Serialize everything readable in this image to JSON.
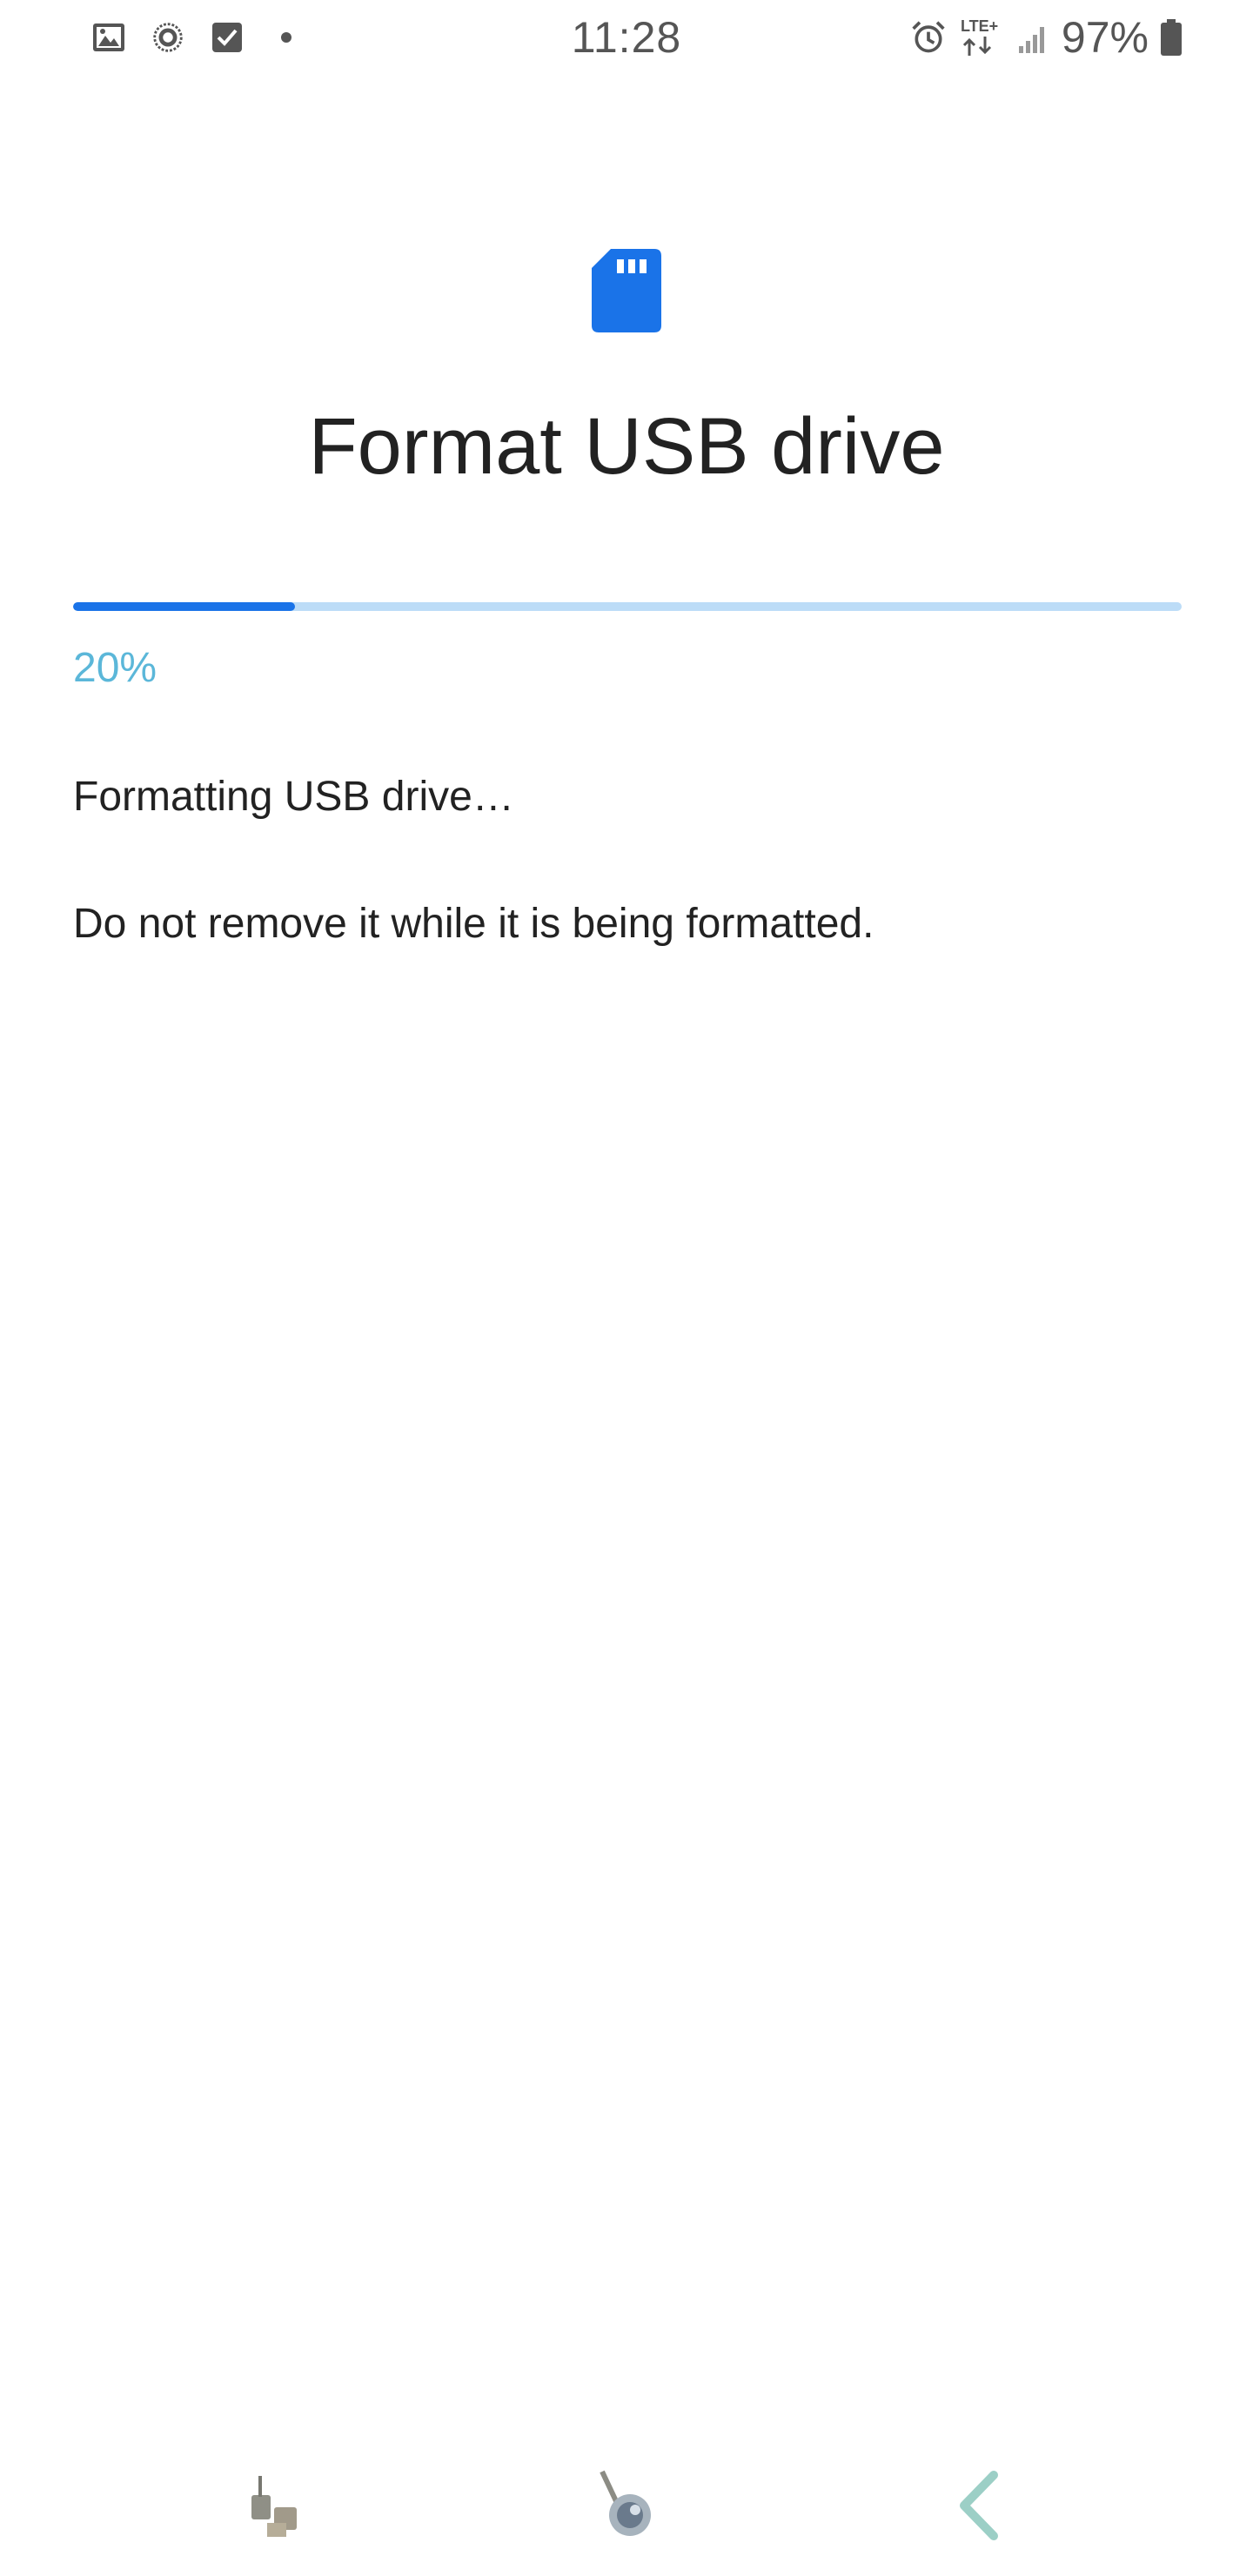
{
  "status_bar": {
    "time": "11:28",
    "battery_percent": "97%",
    "network_label": "LTE+",
    "left_icons": [
      "gallery-icon",
      "brightness-icon",
      "checkbox-icon",
      "dot-icon"
    ],
    "right_icons": [
      "alarm-icon",
      "lte-data-icon",
      "signal-icon",
      "battery-icon"
    ]
  },
  "header": {
    "icon": "sd-card-icon",
    "title": "Format USB drive"
  },
  "progress": {
    "value": 0.2,
    "label": "20%"
  },
  "messages": {
    "status": "Formatting USB drive…",
    "warning": "Do not remove it while it is being formatted."
  },
  "nav_bar": {
    "buttons": [
      "recent-apps-icon",
      "home-icon",
      "back-icon"
    ]
  },
  "colors": {
    "accent": "#1a73e8",
    "progress_track": "#bcdcf7",
    "percent_text": "#5bb7d9",
    "text": "#222222",
    "status_text": "#555555"
  }
}
